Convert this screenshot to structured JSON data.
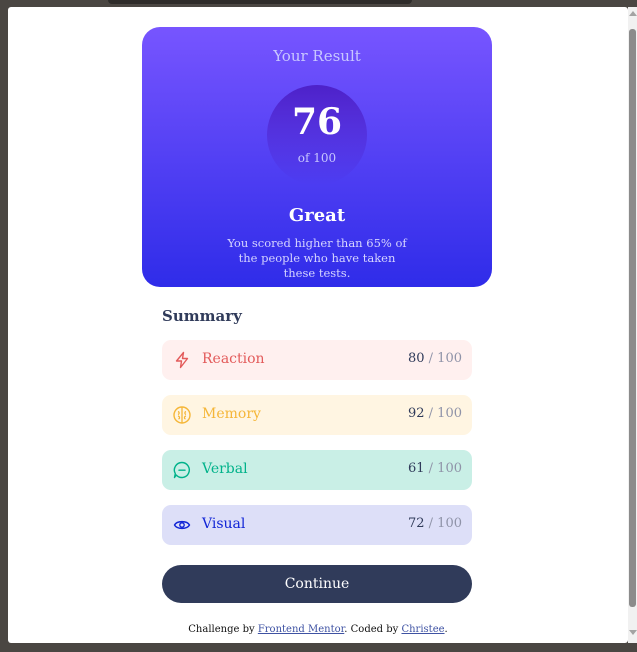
{
  "result": {
    "title": "Your Result",
    "score": "76",
    "of_label": "of 100",
    "verdict": "Great",
    "description": "You scored higher than 65% of the people who have taken these tests."
  },
  "summary": {
    "title": "Summary",
    "items": [
      {
        "label": "Reaction",
        "score": "80",
        "max": " / 100",
        "color": "#e35b5b",
        "bg": "#fff0ef",
        "icon": "lightning-icon"
      },
      {
        "label": "Memory",
        "score": "92",
        "max": " / 100",
        "color": "#f5b638",
        "bg": "#fff5e2",
        "icon": "brain-icon"
      },
      {
        "label": "Verbal",
        "score": "61",
        "max": " / 100",
        "color": "#00b28a",
        "bg": "#c9efe6",
        "icon": "chat-icon"
      },
      {
        "label": "Visual",
        "score": "72",
        "max": " / 100",
        "color": "#1125d6",
        "bg": "#dddff8",
        "icon": "eye-icon"
      }
    ]
  },
  "continue_label": "Continue",
  "attribution": {
    "prefix": "Challenge by ",
    "link1": "Frontend Mentor",
    "middle": ". Coded by ",
    "link2": "Christee",
    "suffix": "."
  }
}
